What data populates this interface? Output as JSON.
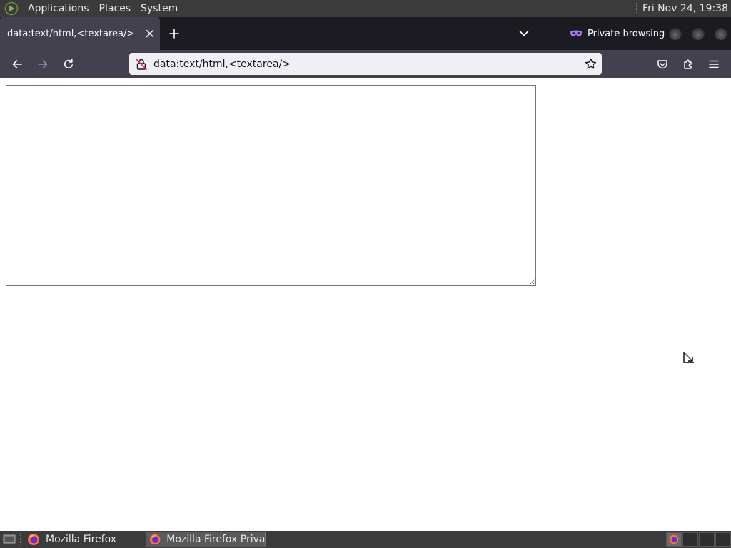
{
  "top_panel": {
    "menus": [
      "Applications",
      "Places",
      "System"
    ],
    "clock": "Fri Nov 24, 19:38"
  },
  "browser": {
    "tab": {
      "title": "data:text/html,<textarea/>"
    },
    "private_label": "Private browsing",
    "url": "data:text/html,<textarea/>"
  },
  "page": {
    "textarea_value": ""
  },
  "taskbar": {
    "tasks": [
      {
        "label": "Mozilla Firefox"
      },
      {
        "label": "Mozilla Firefox Priva…"
      }
    ]
  }
}
